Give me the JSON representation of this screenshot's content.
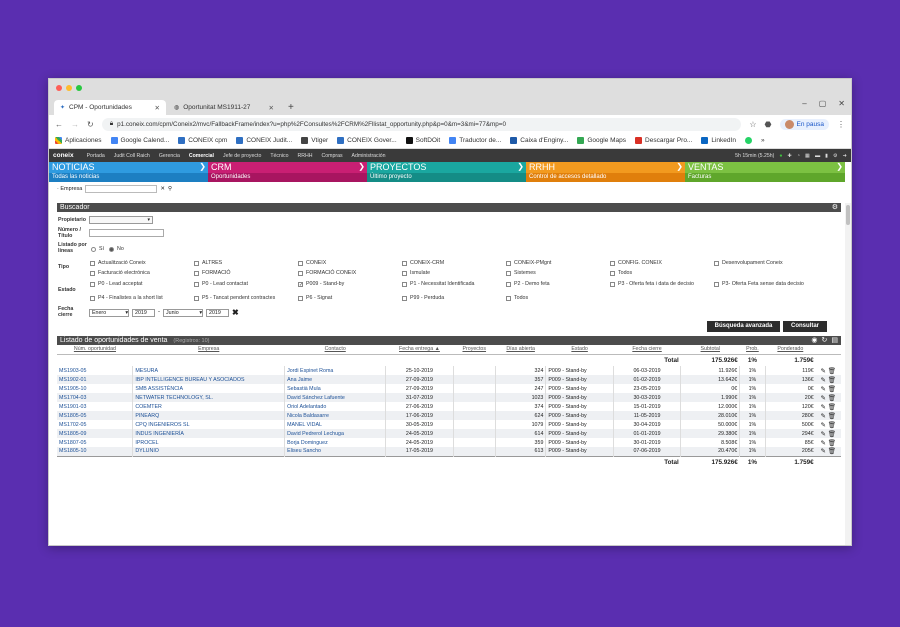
{
  "browser": {
    "tabs": [
      {
        "title": "CPM - Oportunidades",
        "icon": "crm-favicon-icon",
        "active": true
      },
      {
        "title": "Oportunitat MS1911-27",
        "icon": "globe-icon",
        "active": false
      }
    ],
    "url": "p1.coneix.com/cpm/Coneix2/mvc/FallbackFrame/index?u=php%2FConsultes%2FCRM%2Fllistat_opportunity.php&p=0&m=3&mi=77&mp=0",
    "pause_label": "En pausa",
    "bookmarks": [
      "Aplicaciones",
      "Google Calend...",
      "CONEIX cpm",
      "CONEIX Judit...",
      "Vtiger",
      "CONEIX Gover...",
      "SoftDOit",
      "Traductor de...",
      "Caixa d'Enginy...",
      "Google Maps",
      "Descargar Pro...",
      "LinkedIn"
    ]
  },
  "appbar": {
    "logo": "coneix",
    "items": [
      "Portada",
      "Judit Coll Raich",
      "Gerencia",
      "Comercial",
      "Jefe de proyecto",
      "Técnico",
      "RRHH",
      "Compras",
      "Administración"
    ],
    "active": "Comercial",
    "timer": "5h 15min (5.25h)"
  },
  "modules": [
    {
      "title": "NOTICIAS",
      "sub": "Todas las noticias",
      "color": "#2f9be0",
      "subcolor": "#1d7fc2"
    },
    {
      "title": "CRM",
      "sub": "Oportunidades",
      "color": "#c91f73",
      "subcolor": "#a81560"
    },
    {
      "title": "PROYECTOS",
      "sub": "Último proyecto",
      "color": "#1aa7a0",
      "subcolor": "#148c86"
    },
    {
      "title": "RRHH",
      "sub": "Control de accesos detallado",
      "color": "#f29a1f",
      "subcolor": "#e07f0c"
    },
    {
      "title": "VENTAS",
      "sub": "Facturas",
      "color": "#7cc142",
      "subcolor": "#5fa62b"
    }
  ],
  "empresa_label": "· Empresa",
  "buscador": {
    "title": "Buscador",
    "labels": {
      "propietario": "Propietario",
      "numero": "Número / Título",
      "listado": "Listado por líneas",
      "tipo": "Tipo",
      "estado": "Estado",
      "fecha": "Fecha cierre"
    },
    "listado_options": [
      "Sí",
      "No"
    ],
    "tipo_options": [
      "Actualització Coneix",
      "ALTRES",
      "CONEIX",
      "CONEIX-CRM",
      "CONEIX-PMgnt",
      "CONFIG. CONEIX",
      "Desenvolupament Coneix",
      "Facturació electrónica",
      "FORMACIÓ",
      "FORMACIÓ CONEIX",
      "Ismulate",
      "Sistemes",
      "Todos"
    ],
    "estado_options": [
      "P0 - Lead acceptat",
      "P0 - Lead contactat",
      "P009 - Stand-by",
      "P1 - Necessitat Identificada",
      "P2 - Demo feta",
      "P3 - Oferta feta i data de decisio",
      "P3- Oferta Feta sense data decisio",
      "P4 - Finalistes a la short list",
      "P5 - Tancat pendent contractes",
      "P6 - Signat",
      "P99 - Perduda",
      "Todos"
    ],
    "estado_checked": "P009 - Stand-by",
    "fecha_from_month": "Enero",
    "fecha_from_year": "2019",
    "fecha_to_month": "Junio",
    "fecha_to_year": "2019",
    "btn_avanzada": "Búsqueda avanzada",
    "btn_consultar": "Consultar"
  },
  "listado": {
    "title": "Listado de oportunidades de venta",
    "count": "(Registros: 10)",
    "columns": [
      "Núm. oportunidad",
      "Empresa",
      "Contacto",
      "Fecha entrega ▲",
      "Proyectos",
      "Días abierta",
      "Estado",
      "Fecha cierre",
      "Subtotal",
      "Prob.",
      "Ponderado"
    ],
    "total_label": "Total",
    "total_subtotal": "175.926€",
    "total_prob": "1%",
    "total_ponderado": "1.759€",
    "rows": [
      {
        "num": "MS1903-05",
        "empresa": "MESURA",
        "contacto": "Jordi Espinet Roma",
        "entrega": "25-10-2019",
        "dias": "324",
        "estado": "P009 - Stand-by",
        "cierre": "06-03-2019",
        "subtotal": "11.926€",
        "prob": "1%",
        "pond": "119€"
      },
      {
        "num": "MS1902-01",
        "empresa": "IBP INTELLIGENCE BUREAU Y ASOCIADOS",
        "contacto": "Ana Jaime",
        "entrega": "27-09-2019",
        "dias": "357",
        "estado": "P009 - Stand-by",
        "cierre": "01-02-2019",
        "subtotal": "13.642€",
        "prob": "1%",
        "pond": "136€"
      },
      {
        "num": "MS1905-10",
        "empresa": "SMB ASSISTÈNCIA",
        "contacto": "Sebastià Mula",
        "entrega": "27-09-2019",
        "dias": "247",
        "estado": "P009 - Stand-by",
        "cierre": "23-05-2019",
        "subtotal": "0€",
        "prob": "1%",
        "pond": "0€"
      },
      {
        "num": "MS1704-03",
        "empresa": "NETWATER TECHNOLOGY, SL.",
        "contacto": "David Sánchez Lafuente",
        "entrega": "31-07-2019",
        "dias": "1023",
        "estado": "P009 - Stand-by",
        "cierre": "30-03-2019",
        "subtotal": "1.990€",
        "prob": "1%",
        "pond": "20€"
      },
      {
        "num": "MS1901-03",
        "empresa": "COEMTER",
        "contacto": "Oriol Adelantado",
        "entrega": "27-06-2019",
        "dias": "374",
        "estado": "P009 - Stand-by",
        "cierre": "15-01-2019",
        "subtotal": "12.000€",
        "prob": "1%",
        "pond": "120€"
      },
      {
        "num": "MS1805-05",
        "empresa": "PINEARQ",
        "contacto": "Nicola Baldasarre",
        "entrega": "17-06-2019",
        "dias": "624",
        "estado": "P009 - Stand-by",
        "cierre": "11-05-2019",
        "subtotal": "28.010€",
        "prob": "1%",
        "pond": "280€"
      },
      {
        "num": "MS1702-05",
        "empresa": "CPQ INGENIEROS SL",
        "contacto": "MANEL VIDAL",
        "entrega": "30-05-2019",
        "dias": "1079",
        "estado": "P009 - Stand-by",
        "cierre": "30-04-2019",
        "subtotal": "50.000€",
        "prob": "1%",
        "pond": "500€"
      },
      {
        "num": "MS1805-09",
        "empresa": "INDUS INGENIERÍA",
        "contacto": "David Pedrerol Lechuga",
        "entrega": "24-05-2019",
        "dias": "614",
        "estado": "P009 - Stand-by",
        "cierre": "01-01-2019",
        "subtotal": "29.380€",
        "prob": "1%",
        "pond": "294€"
      },
      {
        "num": "MS1807-05",
        "empresa": "IPROCEL",
        "contacto": "Borja Dominguez",
        "entrega": "24-05-2019",
        "dias": "359",
        "estado": "P009 - Stand-by",
        "cierre": "30-01-2019",
        "subtotal": "8.508€",
        "prob": "1%",
        "pond": "85€"
      },
      {
        "num": "MS1805-10",
        "empresa": "DYLUNIO",
        "contacto": "Eliseu Sancho",
        "entrega": "17-05-2019",
        "dias": "613",
        "estado": "P009 - Stand-by",
        "cierre": "07-06-2019",
        "subtotal": "20.470€",
        "prob": "1%",
        "pond": "205€"
      }
    ]
  }
}
